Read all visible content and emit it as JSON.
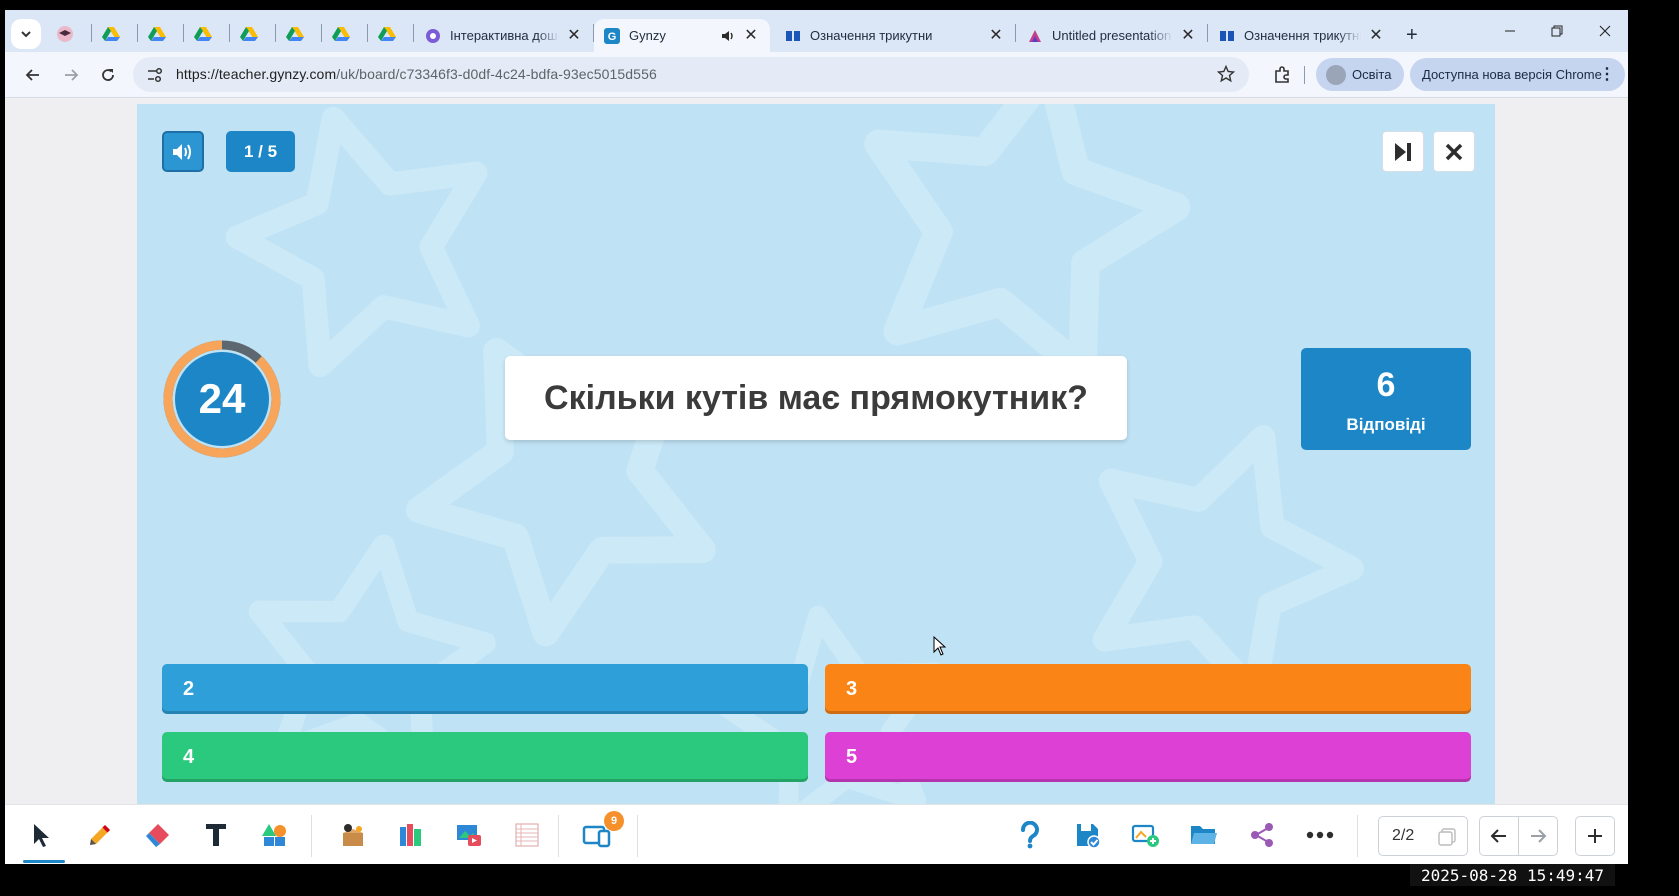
{
  "browser": {
    "tabs": [
      {
        "title": "Інтерактивна дошка",
        "favicon": "gynzy-purple-icon"
      },
      {
        "title": "Gynzy",
        "favicon": "gynzy-icon",
        "active": true,
        "audio": true
      },
      {
        "title": "Означення трикутни",
        "favicon": "book-icon"
      },
      {
        "title": "Untitled presentation",
        "favicon": "gamma-icon"
      },
      {
        "title": "Означення трикутни",
        "favicon": "book-icon"
      }
    ],
    "new_tab": "+",
    "url_host": "https://teacher.gynzy.com",
    "url_path": "/uk/board/c73346f3-d0df-4c24-bdfa-93ec5015d556",
    "profile_label": "Освіта",
    "update_label": "Доступна нова версія Chrome"
  },
  "quiz": {
    "counter": "1 / 5",
    "timer": "24",
    "timer_remaining_fraction": 0.88,
    "question": "Скільки кутів має прямокутник?",
    "answers_count": "6",
    "answers_label": "Відповіді",
    "options": [
      {
        "label": "2",
        "color": "#2e9fd8"
      },
      {
        "label": "3",
        "color": "#fb8417"
      },
      {
        "label": "4",
        "color": "#2bc97d"
      },
      {
        "label": "5",
        "color": "#dc40d5"
      }
    ]
  },
  "board": {
    "page_indicator": "2/2",
    "notifications_badge": "9"
  },
  "timestamp": "2025-08-28 15:49:47",
  "colors": {
    "accent_blue": "#1d86c6",
    "timer_orange": "#f6a55a",
    "stage_bg": "#bfe2f4"
  }
}
